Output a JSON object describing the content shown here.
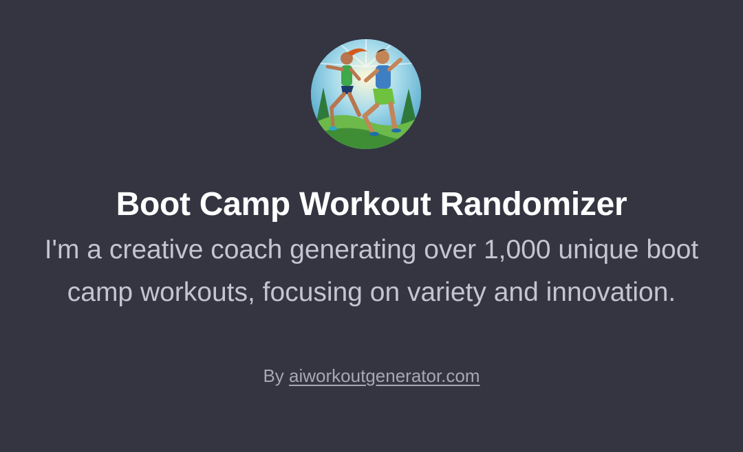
{
  "gpt": {
    "avatar_icon": "two-athletes-workout-illustration",
    "title": "Boot Camp Workout Randomizer",
    "description": "I'm a creative coach generating over 1,000 unique boot camp workouts, focusing on variety and innovation.",
    "byline_prefix": "By",
    "author_link": "aiworkoutgenerator.com"
  },
  "colors": {
    "background": "#343541",
    "title": "#ffffff",
    "description": "#c5c5d2",
    "byline": "#a8a8b4"
  }
}
